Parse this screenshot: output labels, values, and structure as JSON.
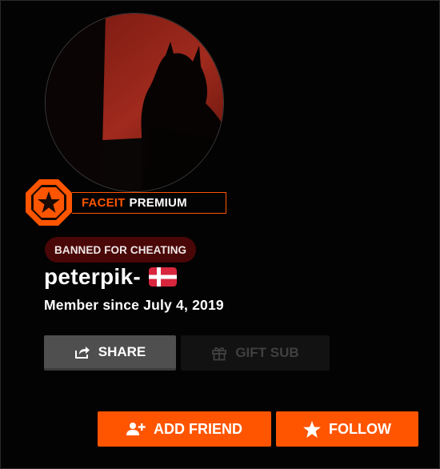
{
  "profile": {
    "username": "peterpik-",
    "member_since": "Member since July 4, 2019",
    "status_badge": "BANNED FOR CHEATING",
    "country_flag_icon": "denmark-flag-icon"
  },
  "premium": {
    "brand": "FACEIT",
    "label": "PREMIUM",
    "icon": "star-octagon-icon"
  },
  "actions": {
    "share_label": "SHARE",
    "share_icon": "share-icon",
    "gift_label": "GIFT SUB",
    "gift_icon": "gift-icon",
    "add_friend_label": "ADD FRIEND",
    "add_friend_icon": "add-user-icon",
    "follow_label": "FOLLOW",
    "follow_icon": "star-icon"
  },
  "colors": {
    "accent": "#ff5500",
    "background": "#030303",
    "banned_bg": "#4a0707",
    "share_bg": "#4f4f4f",
    "gift_bg": "#121212"
  }
}
